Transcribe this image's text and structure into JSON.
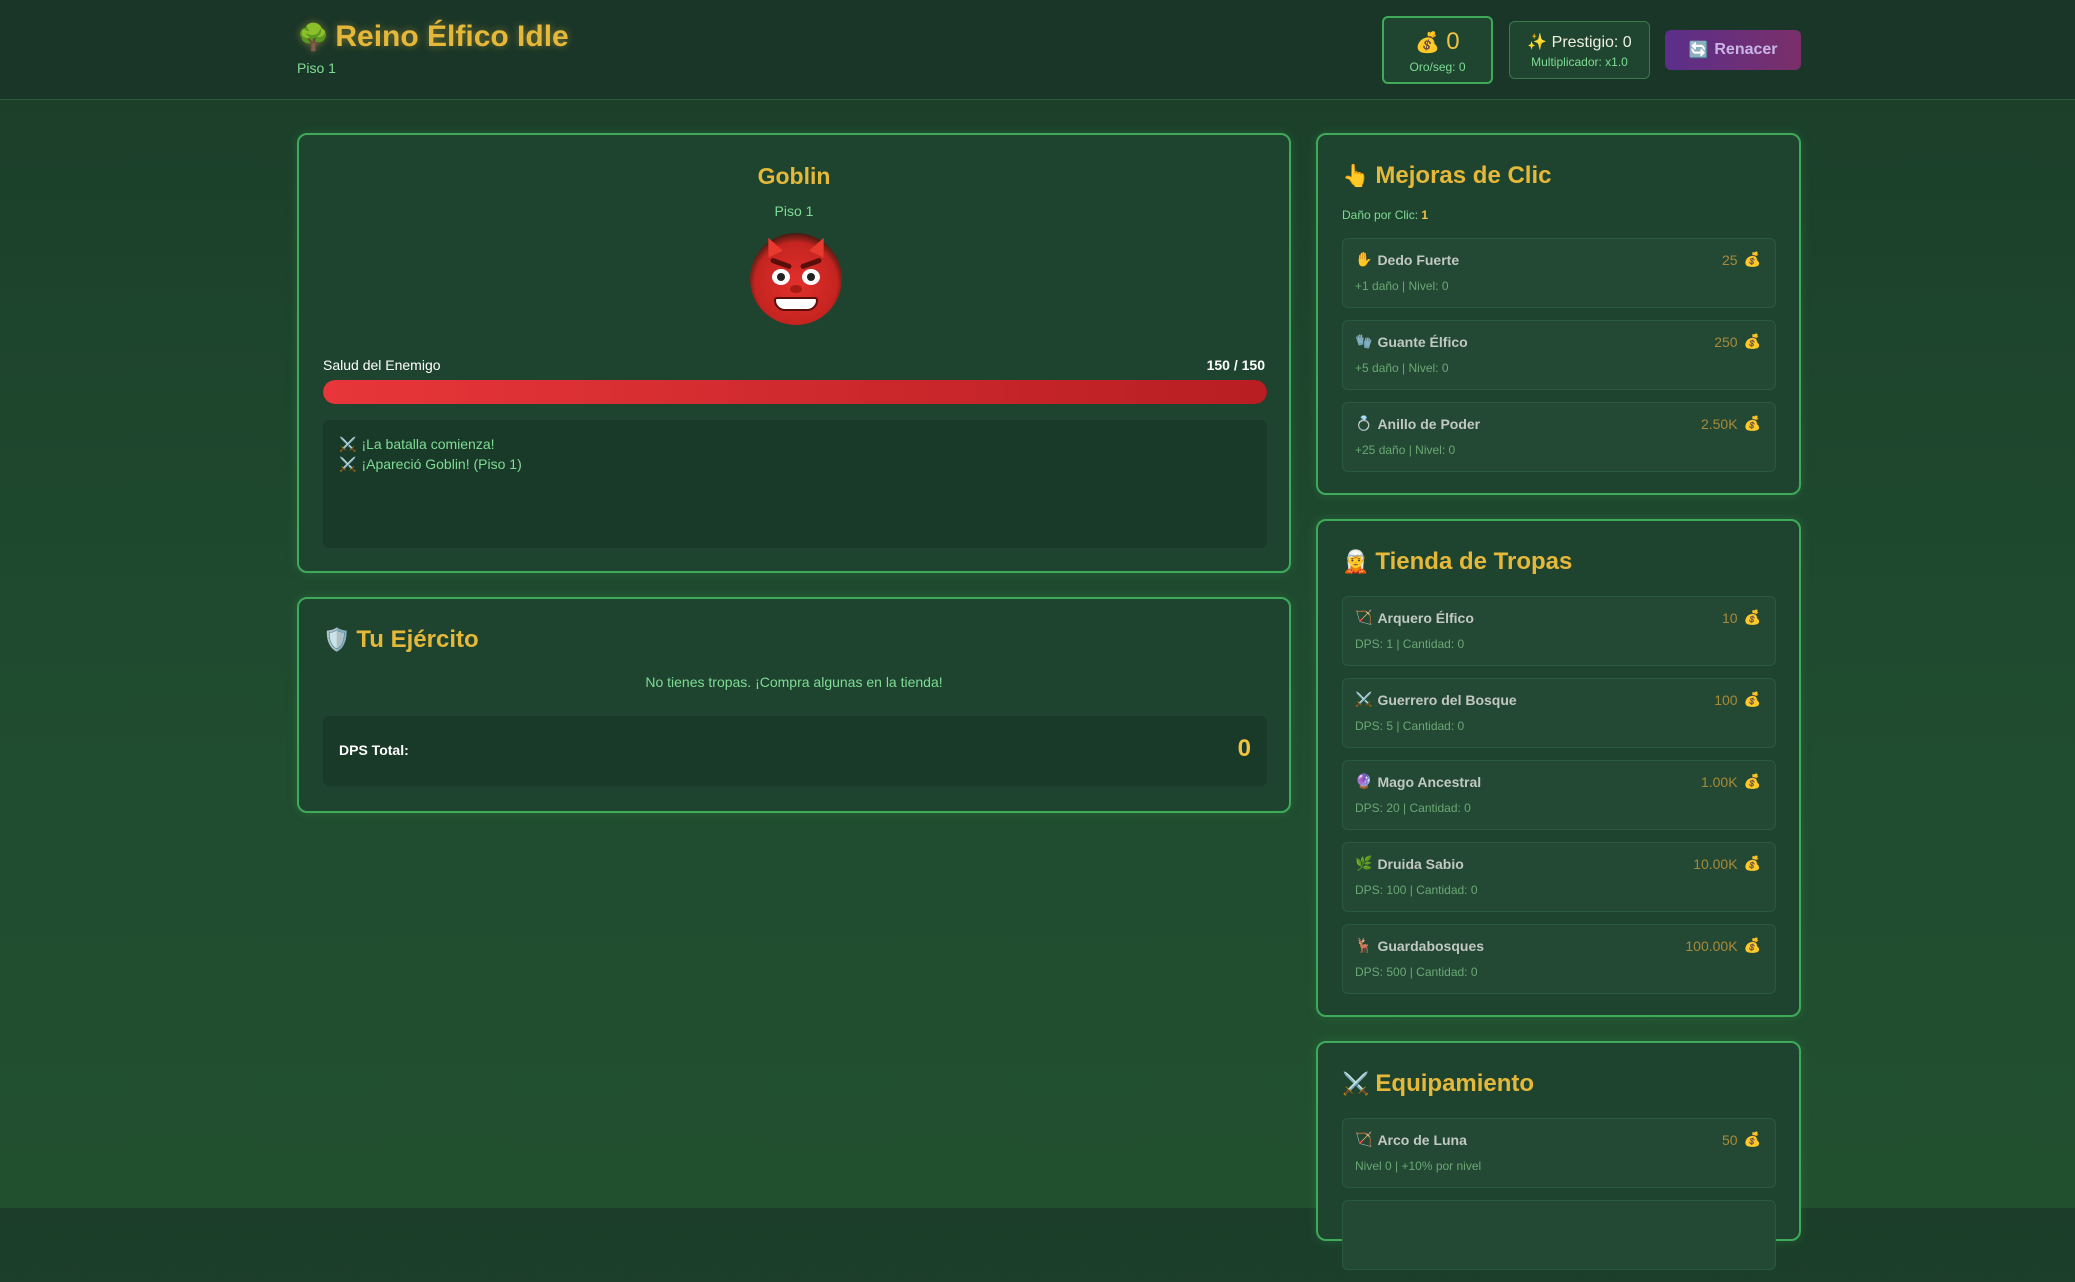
{
  "header": {
    "title": "Reino Élfico Idle",
    "title_icon": "tree-icon",
    "subtitle": "Piso 1",
    "gold": "0",
    "gold_rate": "Oro/seg: 0",
    "prestige": "Prestigio: 0",
    "multiplier": "Multiplicador: x1.0",
    "rebirth_label": "Renacer"
  },
  "enemy": {
    "name": "Goblin",
    "floor": "Piso 1",
    "hp_label": "Salud del Enemigo",
    "hp_text": "150 / 150",
    "hp_current": 150,
    "hp_max": 150,
    "log": [
      "¡La batalla comienza!",
      "¡Apareció Goblin! (Piso 1)"
    ]
  },
  "army": {
    "title": "Tu Ejército",
    "empty_text": "No tienes tropas. ¡Compra algunas en la tienda!",
    "dps_label": "DPS Total:",
    "dps_value": "0"
  },
  "click_upgrades": {
    "title": "Mejoras de Clic",
    "damage_label": "Daño por Clic:",
    "damage_value": "1",
    "items": [
      {
        "icon": "✋",
        "name": "Dedo Fuerte",
        "cost": "25",
        "desc": "+1 daño | Nivel: 0"
      },
      {
        "icon": "🧤",
        "name": "Guante Élfico",
        "cost": "250",
        "desc": "+5 daño | Nivel: 0"
      },
      {
        "icon": "💍",
        "name": "Anillo de Poder",
        "cost": "2.50K",
        "desc": "+25 daño | Nivel: 0"
      }
    ]
  },
  "troop_shop": {
    "title": "Tienda de Tropas",
    "items": [
      {
        "icon": "🏹",
        "name": "Arquero Élfico",
        "cost": "10",
        "desc": "DPS: 1 | Cantidad: 0"
      },
      {
        "icon": "⚔️",
        "name": "Guerrero del Bosque",
        "cost": "100",
        "desc": "DPS: 5 | Cantidad: 0"
      },
      {
        "icon": "🔮",
        "name": "Mago Ancestral",
        "cost": "1.00K",
        "desc": "DPS: 20 | Cantidad: 0"
      },
      {
        "icon": "🌿",
        "name": "Druida Sabio",
        "cost": "10.00K",
        "desc": "DPS: 100 | Cantidad: 0"
      },
      {
        "icon": "🦌",
        "name": "Guardabosques",
        "cost": "100.00K",
        "desc": "DPS: 500 | Cantidad: 0"
      }
    ]
  },
  "equipment": {
    "title": "Equipamiento",
    "items": [
      {
        "icon": "🏹",
        "name": "Arco de Luna",
        "cost": "50",
        "desc": "Nivel 0 | +10% por nivel"
      },
      {
        "icon": "",
        "name": "",
        "cost": "",
        "desc": ""
      }
    ]
  },
  "colors": {
    "accent_gold": "#e6b83a",
    "panel_border": "#3faa5a",
    "text_green": "#7fdc93",
    "hp_red": "#e8363a",
    "rebirth_purple": "#5b2f8a"
  }
}
